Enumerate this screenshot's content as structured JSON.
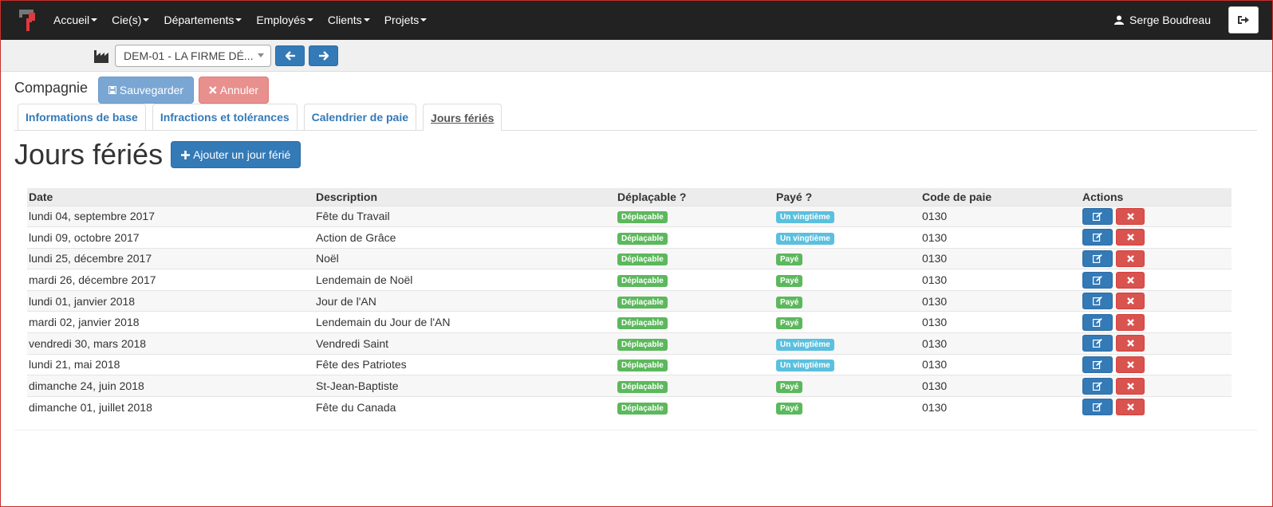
{
  "navbar": {
    "menu": [
      "Accueil",
      "Cie(s)",
      "Départements",
      "Employés",
      "Clients",
      "Projets"
    ],
    "user_name": "Serge Boudreau"
  },
  "subbar": {
    "company_select": "DEM-01 - LA FIRME DÉ..."
  },
  "company": {
    "label": "Compagnie",
    "save_label": "Sauvegarder",
    "cancel_label": "Annuler"
  },
  "tabs": [
    "Informations de base",
    "Infractions et tolérances",
    "Calendrier de paie",
    "Jours fériés"
  ],
  "page": {
    "title": "Jours fériés",
    "add_label": "Ajouter un jour férié"
  },
  "table": {
    "headers": [
      "Date",
      "Description",
      "Déplaçable ?",
      "Payé ?",
      "Code de paie",
      "Actions"
    ],
    "rows": [
      {
        "date": "lundi 04, septembre 2017",
        "description": "Fête du Travail",
        "movable": "Déplaçable",
        "paid": "Un vingtième",
        "paid_type": "info",
        "code": "0130"
      },
      {
        "date": "lundi 09, octobre 2017",
        "description": "Action de Grâce",
        "movable": "Déplaçable",
        "paid": "Un vingtième",
        "paid_type": "info",
        "code": "0130"
      },
      {
        "date": "lundi 25, décembre 2017",
        "description": "Noël",
        "movable": "Déplaçable",
        "paid": "Payé",
        "paid_type": "success",
        "code": "0130"
      },
      {
        "date": "mardi 26, décembre 2017",
        "description": "Lendemain de Noël",
        "movable": "Déplaçable",
        "paid": "Payé",
        "paid_type": "success",
        "code": "0130"
      },
      {
        "date": "lundi 01, janvier 2018",
        "description": "Jour de l'AN",
        "movable": "Déplaçable",
        "paid": "Payé",
        "paid_type": "success",
        "code": "0130"
      },
      {
        "date": "mardi 02, janvier 2018",
        "description": "Lendemain du Jour de l'AN",
        "movable": "Déplaçable",
        "paid": "Payé",
        "paid_type": "success",
        "code": "0130"
      },
      {
        "date": "vendredi 30, mars 2018",
        "description": "Vendredi Saint",
        "movable": "Déplaçable",
        "paid": "Un vingtième",
        "paid_type": "info",
        "code": "0130"
      },
      {
        "date": "lundi 21, mai 2018",
        "description": "Fête des Patriotes",
        "movable": "Déplaçable",
        "paid": "Un vingtième",
        "paid_type": "info",
        "code": "0130"
      },
      {
        "date": "dimanche 24, juin 2018",
        "description": "St-Jean-Baptiste",
        "movable": "Déplaçable",
        "paid": "Payé",
        "paid_type": "success",
        "code": "0130"
      },
      {
        "date": "dimanche 01, juillet 2018",
        "description": "Fête du Canada",
        "movable": "Déplaçable",
        "paid": "Payé",
        "paid_type": "success",
        "code": "0130"
      }
    ]
  },
  "colors": {
    "navbar": "#222222",
    "primary": "#337ab7",
    "danger": "#d9534f",
    "success": "#5cb85c",
    "info": "#5bc0de",
    "logo": "#e0393e"
  }
}
